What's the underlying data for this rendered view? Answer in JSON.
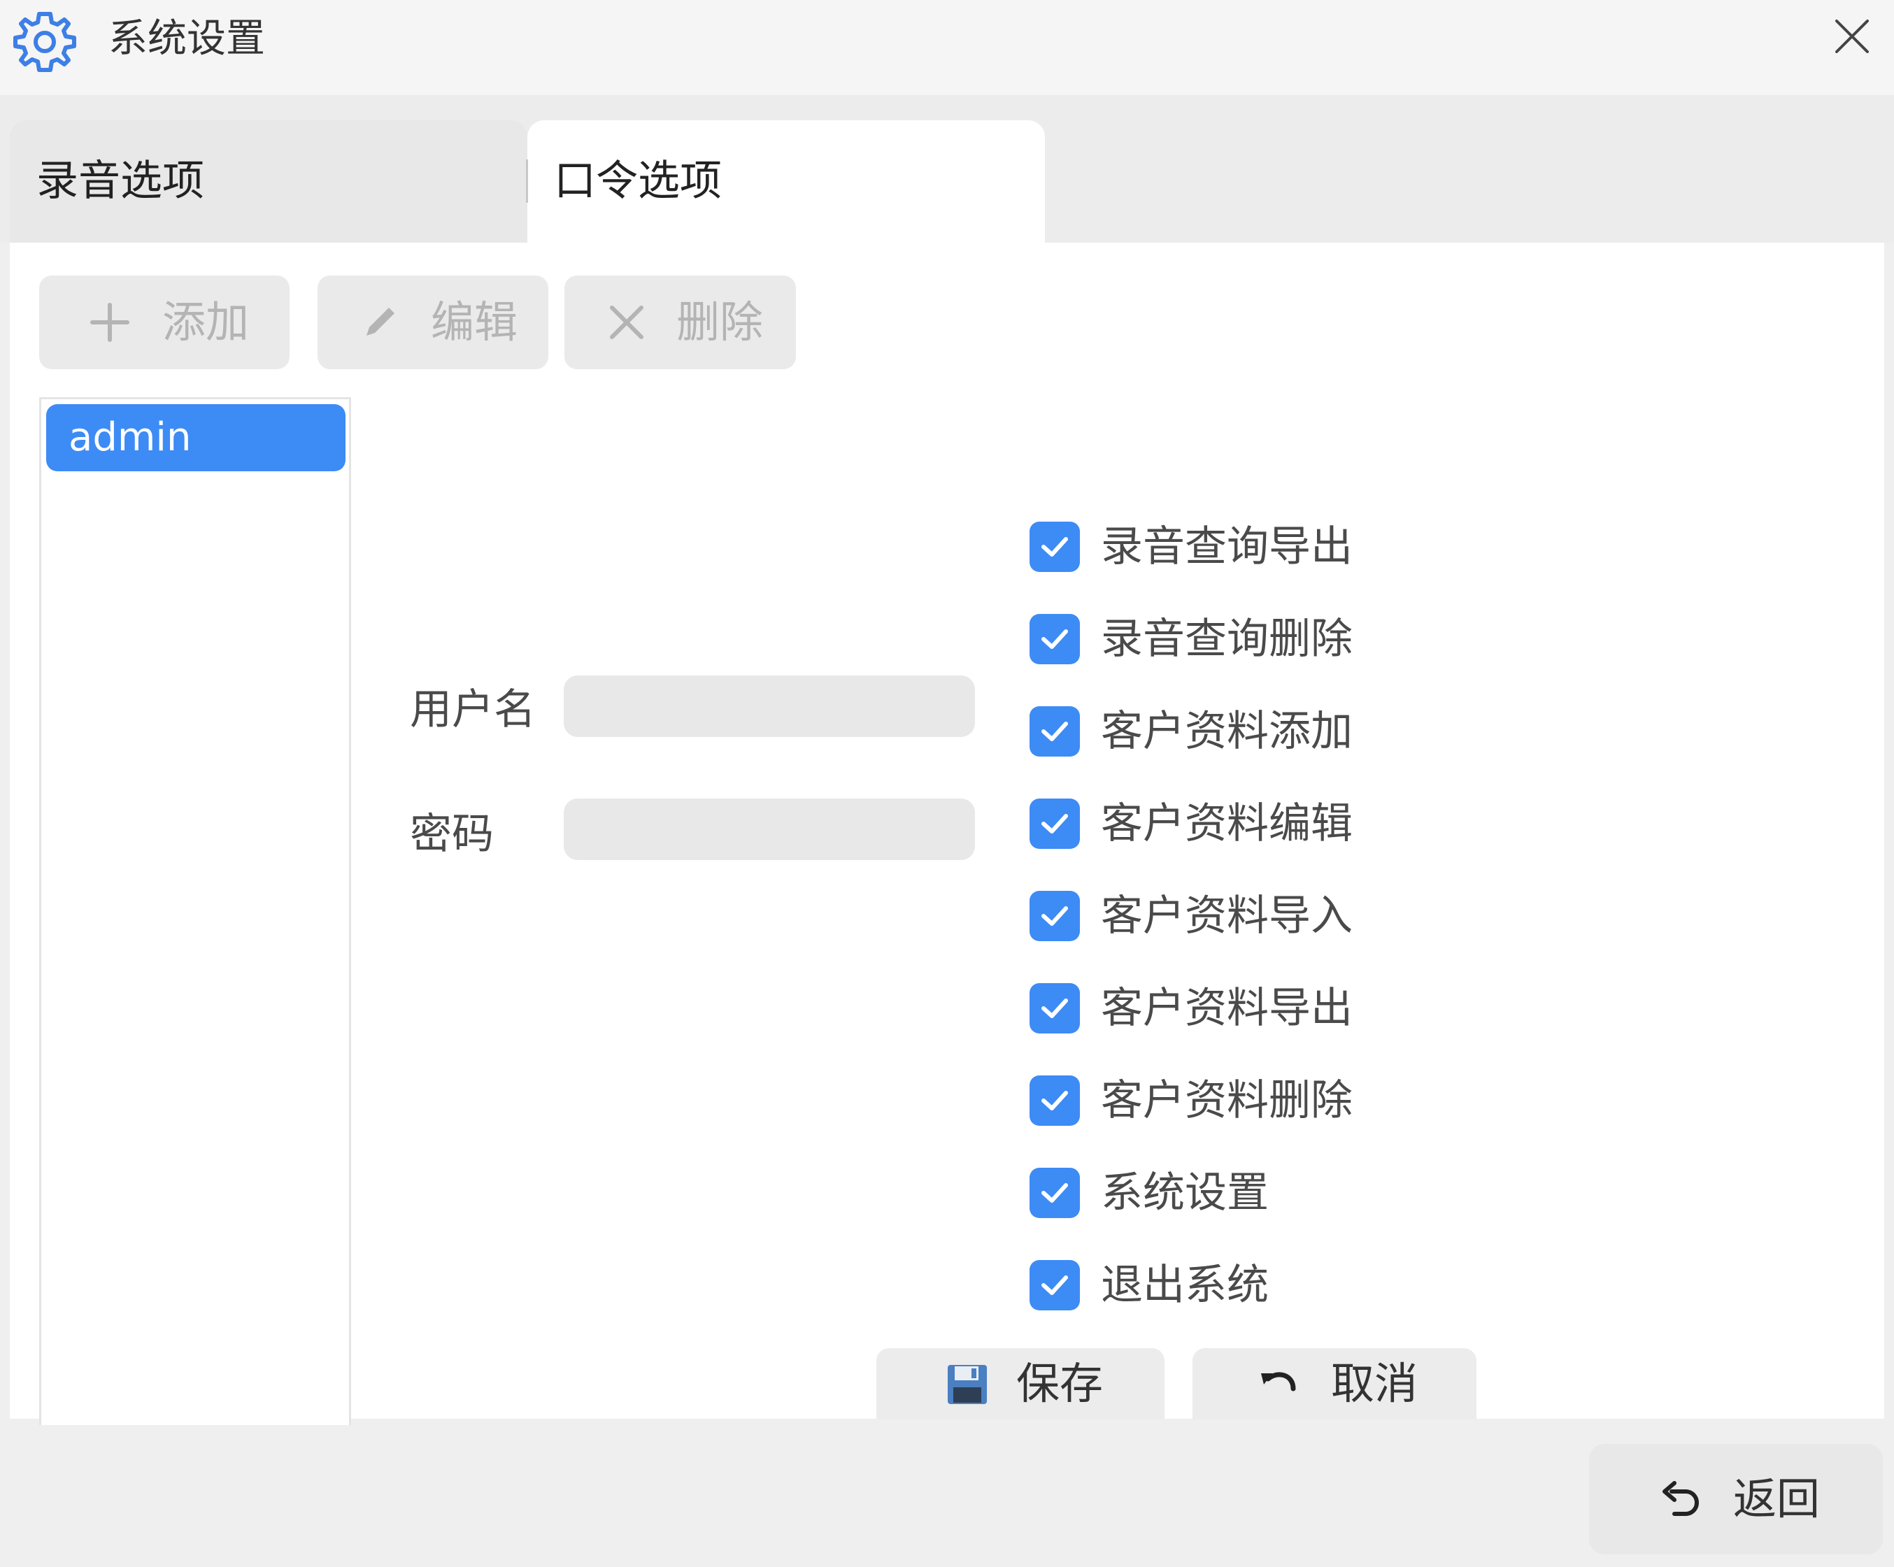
{
  "window": {
    "title": "系统设置",
    "icon": "gear-icon",
    "close_icon": "close-icon"
  },
  "tabs": [
    {
      "label": "录音选项",
      "active": false
    },
    {
      "label": "口令选项",
      "active": true
    }
  ],
  "toolbar": {
    "add_label": "添加",
    "edit_label": "编辑",
    "delete_label": "删除"
  },
  "users": [
    {
      "name": "admin",
      "selected": true
    }
  ],
  "form": {
    "username_label": "用户名",
    "username_value": "",
    "password_label": "密码",
    "password_value": ""
  },
  "permissions": [
    {
      "label": "录音查询导出",
      "checked": true
    },
    {
      "label": "录音查询删除",
      "checked": true
    },
    {
      "label": "客户资料添加",
      "checked": true
    },
    {
      "label": "客户资料编辑",
      "checked": true
    },
    {
      "label": "客户资料导入",
      "checked": true
    },
    {
      "label": "客户资料导出",
      "checked": true
    },
    {
      "label": "客户资料删除",
      "checked": true
    },
    {
      "label": "系统设置",
      "checked": true
    },
    {
      "label": "退出系统",
      "checked": true
    }
  ],
  "actions": {
    "save_label": "保存",
    "cancel_label": "取消",
    "back_label": "返回"
  },
  "colors": {
    "accent": "#3d8bf5",
    "disabled_text": "#b4b4b4",
    "panel": "#ffffff",
    "background": "#efefef"
  }
}
